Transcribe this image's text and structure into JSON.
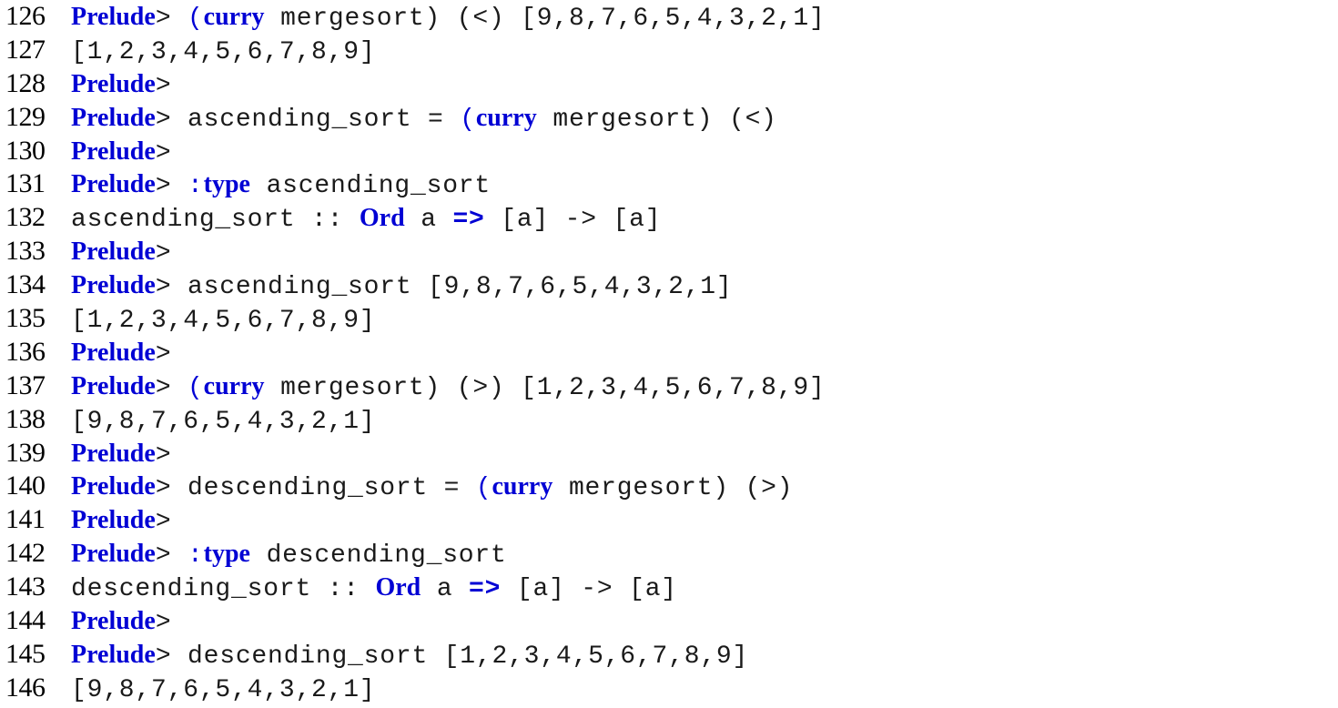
{
  "document": {
    "kind": "code-listing",
    "language": "haskell-ghci",
    "background_color": "#ffffff",
    "line_number_color": "#000000",
    "plain_text_color": "#1a1a1a",
    "keyword_color": "#0000d4",
    "first_line_number": 126,
    "last_line_number": 146
  },
  "lines": [
    {
      "number": "126",
      "text": "Prelude> (curry mergesort) (<) [9,8,7,6,5,4,3,2,1]",
      "tokens": [
        {
          "t": "Prelude",
          "s": "kw"
        },
        {
          "t": "> ",
          "s": "plain"
        },
        {
          "t": "(",
          "s": "blue"
        },
        {
          "t": "curry",
          "s": "kw"
        },
        {
          "t": " mergesort) (<) [9,8,7,6,5,4,3,2,1]",
          "s": "plain"
        }
      ]
    },
    {
      "number": "127",
      "text": "[1,2,3,4,5,6,7,8,9]",
      "tokens": [
        {
          "t": "[1,2,3,4,5,6,7,8,9]",
          "s": "plain"
        }
      ]
    },
    {
      "number": "128",
      "text": "Prelude>",
      "tokens": [
        {
          "t": "Prelude",
          "s": "kw"
        },
        {
          "t": ">",
          "s": "plain"
        }
      ]
    },
    {
      "number": "129",
      "text": "Prelude> ascending_sort = (curry mergesort) (<)",
      "tokens": [
        {
          "t": "Prelude",
          "s": "kw"
        },
        {
          "t": "> ascending_sort = ",
          "s": "plain"
        },
        {
          "t": "(",
          "s": "blue"
        },
        {
          "t": "curry",
          "s": "kw"
        },
        {
          "t": " mergesort) (<)",
          "s": "plain"
        }
      ]
    },
    {
      "number": "130",
      "text": "Prelude>",
      "tokens": [
        {
          "t": "Prelude",
          "s": "kw"
        },
        {
          "t": ">",
          "s": "plain"
        }
      ]
    },
    {
      "number": "131",
      "text": "Prelude> :type ascending_sort",
      "tokens": [
        {
          "t": "Prelude",
          "s": "kw"
        },
        {
          "t": "> ",
          "s": "plain"
        },
        {
          "t": ":",
          "s": "blue"
        },
        {
          "t": "type",
          "s": "kw"
        },
        {
          "t": " ascending_sort",
          "s": "plain"
        }
      ]
    },
    {
      "number": "132",
      "text": "ascending_sort :: Ord a => [a] -> [a]",
      "tokens": [
        {
          "t": "ascending_sort :: ",
          "s": "plain"
        },
        {
          "t": "Ord",
          "s": "kw"
        },
        {
          "t": " a ",
          "s": "plain"
        },
        {
          "t": "=>",
          "s": "blue-bold"
        },
        {
          "t": " [a] -> [a]",
          "s": "plain"
        }
      ]
    },
    {
      "number": "133",
      "text": "Prelude>",
      "tokens": [
        {
          "t": "Prelude",
          "s": "kw"
        },
        {
          "t": ">",
          "s": "plain"
        }
      ]
    },
    {
      "number": "134",
      "text": "Prelude> ascending_sort [9,8,7,6,5,4,3,2,1]",
      "tokens": [
        {
          "t": "Prelude",
          "s": "kw"
        },
        {
          "t": "> ascending_sort [9,8,7,6,5,4,3,2,1]",
          "s": "plain"
        }
      ]
    },
    {
      "number": "135",
      "text": "[1,2,3,4,5,6,7,8,9]",
      "tokens": [
        {
          "t": "[1,2,3,4,5,6,7,8,9]",
          "s": "plain"
        }
      ]
    },
    {
      "number": "136",
      "text": "Prelude>",
      "tokens": [
        {
          "t": "Prelude",
          "s": "kw"
        },
        {
          "t": ">",
          "s": "plain"
        }
      ]
    },
    {
      "number": "137",
      "text": "Prelude> (curry mergesort) (>) [1,2,3,4,5,6,7,8,9]",
      "tokens": [
        {
          "t": "Prelude",
          "s": "kw"
        },
        {
          "t": "> ",
          "s": "plain"
        },
        {
          "t": "(",
          "s": "blue"
        },
        {
          "t": "curry",
          "s": "kw"
        },
        {
          "t": " mergesort) (>) [1,2,3,4,5,6,7,8,9]",
          "s": "plain"
        }
      ]
    },
    {
      "number": "138",
      "text": "[9,8,7,6,5,4,3,2,1]",
      "tokens": [
        {
          "t": "[9,8,7,6,5,4,3,2,1]",
          "s": "plain"
        }
      ]
    },
    {
      "number": "139",
      "text": "Prelude>",
      "tokens": [
        {
          "t": "Prelude",
          "s": "kw"
        },
        {
          "t": ">",
          "s": "plain"
        }
      ]
    },
    {
      "number": "140",
      "text": "Prelude> descending_sort = (curry mergesort) (>)",
      "tokens": [
        {
          "t": "Prelude",
          "s": "kw"
        },
        {
          "t": "> descending_sort = ",
          "s": "plain"
        },
        {
          "t": "(",
          "s": "blue"
        },
        {
          "t": "curry",
          "s": "kw"
        },
        {
          "t": " mergesort) (>)",
          "s": "plain"
        }
      ]
    },
    {
      "number": "141",
      "text": "Prelude>",
      "tokens": [
        {
          "t": "Prelude",
          "s": "kw"
        },
        {
          "t": ">",
          "s": "plain"
        }
      ]
    },
    {
      "number": "142",
      "text": "Prelude> :type descending_sort",
      "tokens": [
        {
          "t": "Prelude",
          "s": "kw"
        },
        {
          "t": "> ",
          "s": "plain"
        },
        {
          "t": ":",
          "s": "blue"
        },
        {
          "t": "type",
          "s": "kw"
        },
        {
          "t": " descending_sort",
          "s": "plain"
        }
      ]
    },
    {
      "number": "143",
      "text": "descending_sort :: Ord a => [a] -> [a]",
      "tokens": [
        {
          "t": "descending_sort :: ",
          "s": "plain"
        },
        {
          "t": "Ord",
          "s": "kw"
        },
        {
          "t": " a ",
          "s": "plain"
        },
        {
          "t": "=>",
          "s": "blue-bold"
        },
        {
          "t": " [a] -> [a]",
          "s": "plain"
        }
      ]
    },
    {
      "number": "144",
      "text": "Prelude>",
      "tokens": [
        {
          "t": "Prelude",
          "s": "kw"
        },
        {
          "t": ">",
          "s": "plain"
        }
      ]
    },
    {
      "number": "145",
      "text": "Prelude> descending_sort [1,2,3,4,5,6,7,8,9]",
      "tokens": [
        {
          "t": "Prelude",
          "s": "kw"
        },
        {
          "t": "> descending_sort [1,2,3,4,5,6,7,8,9]",
          "s": "plain"
        }
      ]
    },
    {
      "number": "146",
      "text": "[9,8,7,6,5,4,3,2,1]",
      "tokens": [
        {
          "t": "[9,8,7,6,5,4,3,2,1]",
          "s": "plain"
        }
      ]
    }
  ]
}
